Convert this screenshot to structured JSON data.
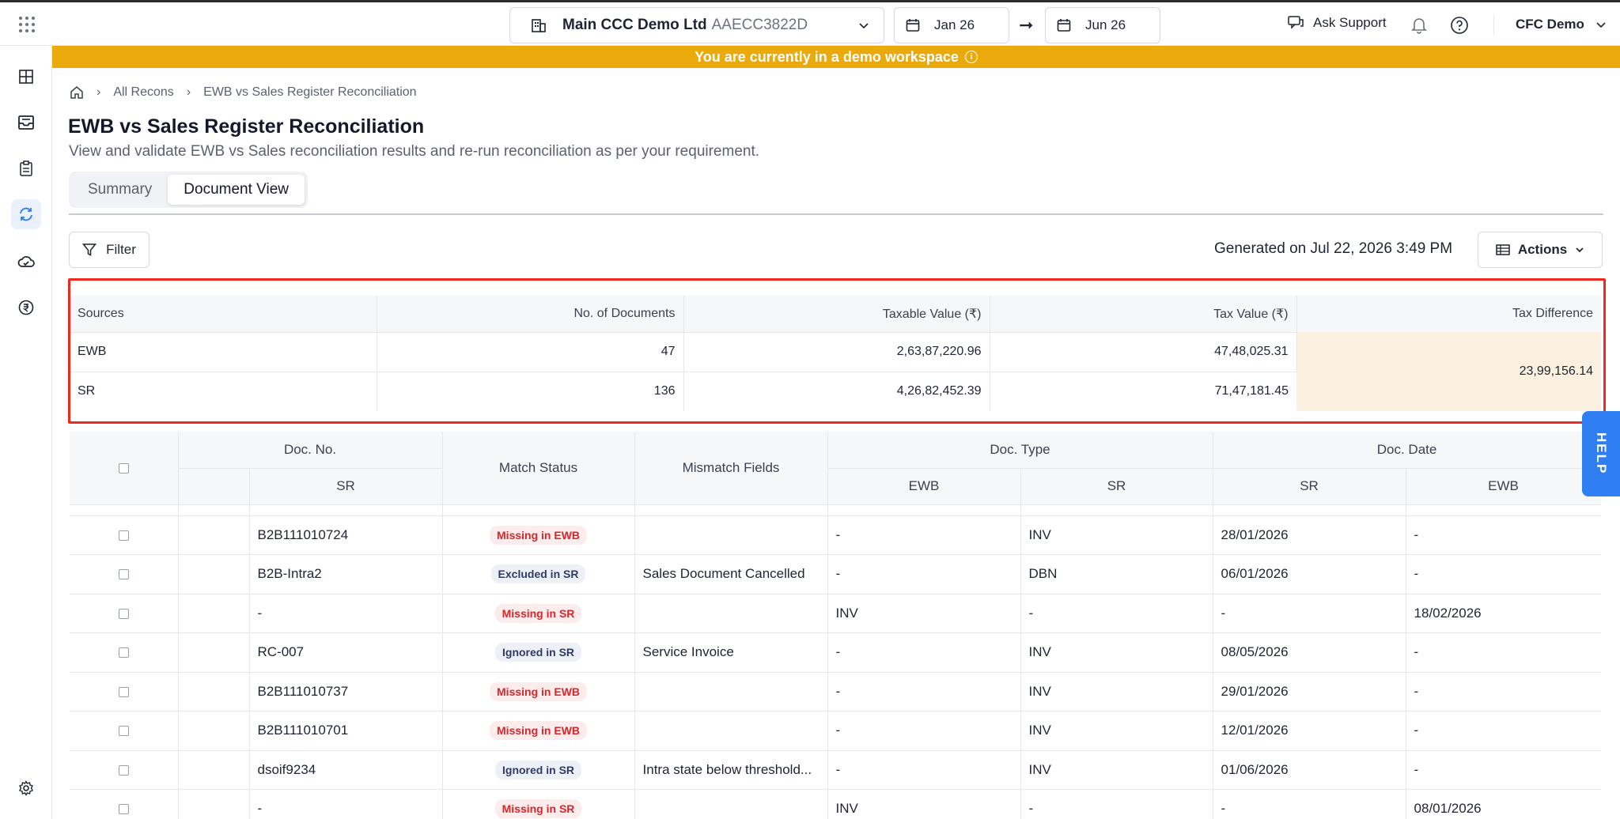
{
  "header": {
    "org_name": "Main CCC Demo Ltd",
    "org_gstin": "AAECC3822D",
    "date_from": "Jan 26",
    "date_to": "Jun 26",
    "ask_support": "Ask Support",
    "user": "CFC Demo"
  },
  "banner": {
    "text": "You are currently in a demo workspace"
  },
  "breadcrumb": {
    "parent": "All Recons",
    "current": "EWB vs Sales Register Reconciliation"
  },
  "page": {
    "title": "EWB vs Sales Register Reconciliation",
    "subtitle": "View and validate EWB vs Sales reconciliation results and re-run reconciliation as per your requirement."
  },
  "tabs": [
    {
      "label": "Summary",
      "active": false
    },
    {
      "label": "Document View",
      "active": true
    }
  ],
  "toolbar": {
    "filter_label": "Filter",
    "generated": "Generated on Jul 22, 2026 3:49 PM",
    "actions_label": "Actions"
  },
  "summary": {
    "headers": [
      "Sources",
      "No. of Documents",
      "Taxable Value (₹)",
      "Tax Value (₹)",
      "Tax Difference"
    ],
    "rows": [
      {
        "source": "EWB",
        "docs": "47",
        "taxable": "2,63,87,220.96",
        "tax": "47,48,025.31"
      },
      {
        "source": "SR",
        "docs": "136",
        "taxable": "4,26,82,452.39",
        "tax": "71,47,181.45"
      }
    ],
    "tax_difference": "23,99,156.14"
  },
  "doc_table": {
    "group_headers": {
      "doc_no": "Doc. No.",
      "match_status": "Match Status",
      "mismatch_fields": "Mismatch Fields",
      "doc_type": "Doc. Type",
      "doc_date": "Doc. Date"
    },
    "sub_headers": {
      "doc_no_sr": "SR",
      "doc_type_ewb": "EWB",
      "doc_type_sr": "SR",
      "doc_date_sr": "SR",
      "doc_date_ewb": "EWB"
    },
    "rows": [
      {
        "doc_no_sr": "B2B111010724",
        "status": "Missing in EWB",
        "status_kind": "missing",
        "mismatch": "",
        "type_ewb": "-",
        "type_sr": "INV",
        "date_sr": "28/01/2026",
        "date_ewb": "-"
      },
      {
        "doc_no_sr": "B2B-Intra2",
        "status": "Excluded in SR",
        "status_kind": "excluded",
        "mismatch": "Sales Document Cancelled",
        "type_ewb": "-",
        "type_sr": "DBN",
        "date_sr": "06/01/2026",
        "date_ewb": "-"
      },
      {
        "doc_no_sr": "-",
        "status": "Missing in SR",
        "status_kind": "missing",
        "mismatch": "",
        "type_ewb": "INV",
        "type_sr": "-",
        "date_sr": "-",
        "date_ewb": "18/02/2026"
      },
      {
        "doc_no_sr": "RC-007",
        "status": "Ignored in SR",
        "status_kind": "ignored",
        "mismatch": "Service Invoice",
        "type_ewb": "-",
        "type_sr": "INV",
        "date_sr": "08/05/2026",
        "date_ewb": "-"
      },
      {
        "doc_no_sr": "B2B111010737",
        "status": "Missing in EWB",
        "status_kind": "missing",
        "mismatch": "",
        "type_ewb": "-",
        "type_sr": "INV",
        "date_sr": "29/01/2026",
        "date_ewb": "-"
      },
      {
        "doc_no_sr": "B2B111010701",
        "status": "Missing in EWB",
        "status_kind": "missing",
        "mismatch": "",
        "type_ewb": "-",
        "type_sr": "INV",
        "date_sr": "12/01/2026",
        "date_ewb": "-"
      },
      {
        "doc_no_sr": "dsoif9234",
        "status": "Ignored in SR",
        "status_kind": "ignored",
        "mismatch": "Intra state below threshold...",
        "type_ewb": "-",
        "type_sr": "INV",
        "date_sr": "01/06/2026",
        "date_ewb": "-"
      },
      {
        "doc_no_sr": "-",
        "status": "Missing in SR",
        "status_kind": "missing",
        "mismatch": "",
        "type_ewb": "INV",
        "type_sr": "-",
        "date_sr": "-",
        "date_ewb": "08/01/2026"
      }
    ]
  },
  "help": {
    "label": "HELP"
  },
  "colors": {
    "banner": "#eaaa0b",
    "accent": "#2f7ef2",
    "highlight": "#f2281e",
    "diff_bg": "#fcf1e0"
  }
}
